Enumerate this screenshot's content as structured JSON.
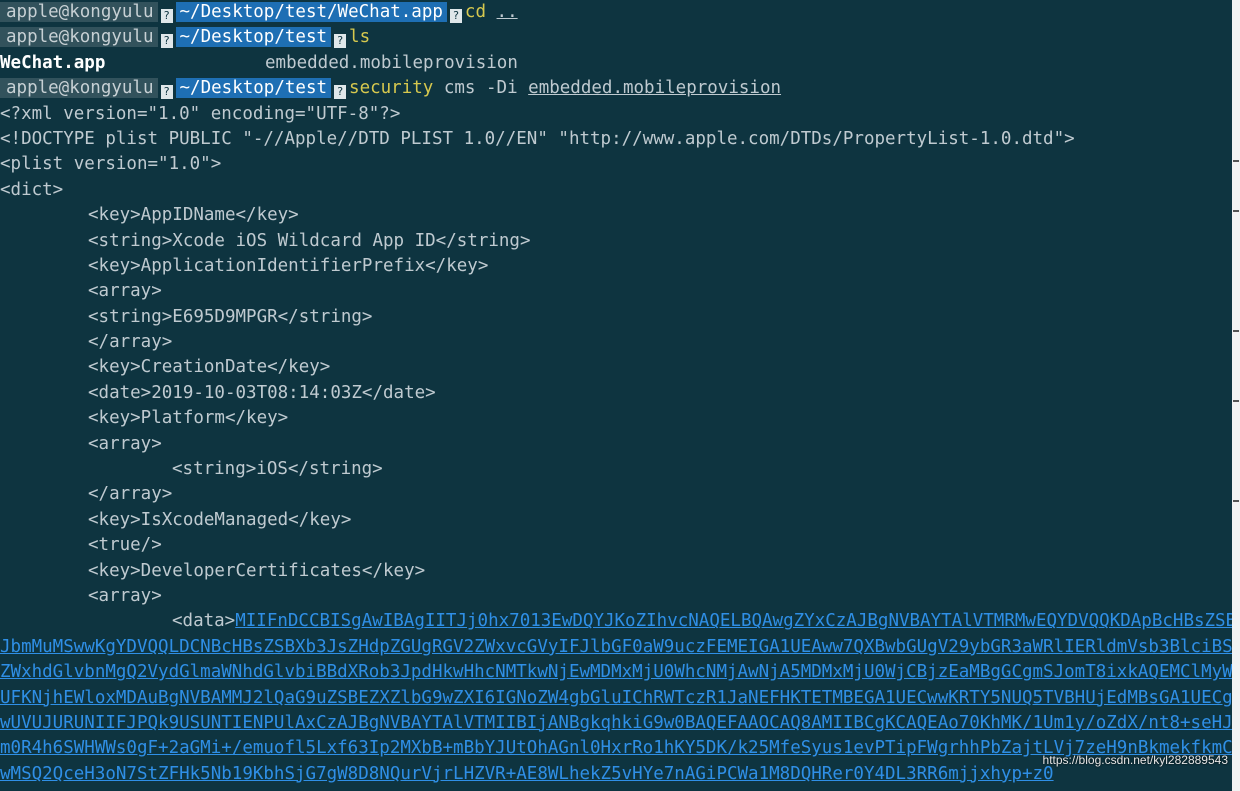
{
  "prompts": [
    {
      "user": "apple@kongyulu",
      "path": "~/Desktop/test/WeChat.app",
      "cmd": "cd",
      "args": "..",
      "glyph": "?"
    },
    {
      "user": "apple@kongyulu",
      "path": "~/Desktop/test",
      "cmd": "ls",
      "args": "",
      "glyph": "?"
    },
    {
      "user": "apple@kongyulu",
      "path": "~/Desktop/test",
      "cmd": "security",
      "args": " cms -Di ",
      "file": "embedded.mobileprovision",
      "glyph": "?"
    }
  ],
  "ls_output": {
    "item1": "WeChat.app",
    "item2": "embedded.mobileprovision"
  },
  "xml_lines": [
    "<?xml version=\"1.0\" encoding=\"UTF-8\"?>",
    "<!DOCTYPE plist PUBLIC \"-//Apple//DTD PLIST 1.0//EN\" \"http://www.apple.com/DTDs/PropertyList-1.0.dtd\">",
    "<plist version=\"1.0\">",
    "<dict>"
  ],
  "dict_lines": [
    {
      "indent": 1,
      "text": "<key>AppIDName</key>"
    },
    {
      "indent": 1,
      "text": "<string>Xcode iOS Wildcard App ID</string>"
    },
    {
      "indent": 1,
      "text": "<key>ApplicationIdentifierPrefix</key>"
    },
    {
      "indent": 1,
      "text": "<array>"
    },
    {
      "indent": 1,
      "text": "<string>E695D9MPGR</string>"
    },
    {
      "indent": 1,
      "text": "</array>"
    },
    {
      "indent": 1,
      "text": "<key>CreationDate</key>"
    },
    {
      "indent": 1,
      "text": "<date>2019-10-03T08:14:03Z</date>"
    },
    {
      "indent": 1,
      "text": "<key>Platform</key>"
    },
    {
      "indent": 1,
      "text": "<array>"
    },
    {
      "indent": 2,
      "text": "<string>iOS</string>"
    },
    {
      "indent": 1,
      "text": "</array>"
    },
    {
      "indent": 1,
      "text": "<key>IsXcodeManaged</key>"
    },
    {
      "indent": 1,
      "text": "<true/>"
    },
    {
      "indent": 1,
      "text": "<key>DeveloperCertificates</key>"
    },
    {
      "indent": 1,
      "text": "<array>"
    }
  ],
  "data_tag": "<data>",
  "data_first": "MIIFnDCCBISgAwIBAgIITJj0hx7013EwDQYJKoZIhvcNAQELBQAwgZYxCzAJBgNVBAYTAlVTMRMwEQYDVQQKDApBcHBsZSB",
  "data_lines": [
    "JbmMuMSwwKgYDVQQLDCNBcHBsZSBXb3JsZHdpZGUgRGV2ZWxvcGVyIFJlbGF0aW9uczFEMEIGA1UEAww7QXBwbGUgV29ybGR3aWRlIERldmVsb3BlciBS",
    "ZWxhdGlvbnMgQ2VydGlmaWNhdGlvbiBBdXRob3JpdHkwHhcNMTkwNjEwMDMxMjU0WhcNMjAwNjA5MDMxMjU0WjCBjzEaMBgGCgmSJomT8ixkAQEMClMyW",
    "UFKNjhEWloxMDAuBgNVBAMMJ2lQaG9uZSBEZXZlbG9wZXI6IGNoZW4gbGluIChRWTczR1JaNEFHKTETMBEGA1UECwwKRTY5NUQ5TVBHUjEdMBsGA1UECg",
    "wUVUJURUNIIFJPQk9USUNTIENPUlAxCzAJBgNVBAYTAlVTMIIBIjANBgkqhkiG9w0BAQEFAAOCAQ8AMIIBCgKCAQEAo70KhMK/1Um1y/oZdX/nt8+seHJ",
    "m0R4h6SWHWWs0gF+2aGMi+/emuofl5Lxf63Ip2MXbB+mBbYJUtOhAGnl0HxrRo1hKY5DK/k25MfeSyus1evPTipFWgrhhPbZajtLVj7zeH9nBkmekfkmC",
    "wMSQ2QceH3oN7StZFHk5Nb19KbhSjG7gW8D8NQurVjrLHZVR+AE8WLhekZ5vHYe7nAGiPCWa1M8DQHRer0Y4DL3RR6mjjxhyp+z0"
  ],
  "watermark": "https://blog.csdn.net/kyl282889543"
}
